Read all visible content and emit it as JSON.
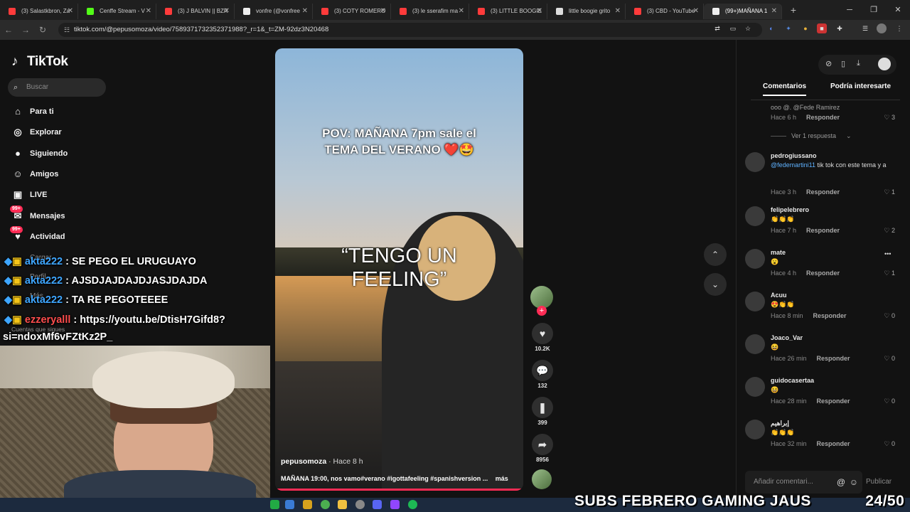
{
  "browser": {
    "tabs": [
      {
        "title": "(3) Salastkbron, Za",
        "color": "#ff3b3b"
      },
      {
        "title": "Cenffe Stream - V",
        "color": "#53fc18"
      },
      {
        "title": "(3) J BALVIN || BZR",
        "color": "#ff3b3b"
      },
      {
        "title": "vonfre (@vonfree",
        "color": "#eeeeee"
      },
      {
        "title": "(3) COTY ROMERO",
        "color": "#ff3b3b"
      },
      {
        "title": "(3) le sserafim ma",
        "color": "#ff3b3b"
      },
      {
        "title": "(3) LITTLE BOOGIE",
        "color": "#ff3b3b"
      },
      {
        "title": "little boogie grito",
        "color": "#dddddd"
      },
      {
        "title": "(3) CBD - YouTube",
        "color": "#ff3b3b"
      },
      {
        "title": "(99+)MAÑANA 1",
        "color": "#eeeeee"
      }
    ],
    "url": "tiktok.com/@pepusomoza/video/7589371732352371988?_r=1&_t=ZM-92dz3N20468"
  },
  "sidebar": {
    "logo": "TikTok",
    "search_placeholder": "Buscar",
    "items": [
      {
        "label": "Para ti",
        "icon": "home-icon",
        "glyph": "⌂"
      },
      {
        "label": "Explorar",
        "icon": "compass-icon",
        "glyph": "◎"
      },
      {
        "label": "Siguiendo",
        "icon": "following-avatar-icon",
        "glyph": "●"
      },
      {
        "label": "Amigos",
        "icon": "friends-icon",
        "glyph": "☺"
      },
      {
        "label": "LIVE",
        "icon": "live-icon",
        "glyph": "▣"
      },
      {
        "label": "Mensajes",
        "icon": "messages-icon",
        "glyph": "✉",
        "badge": "99+"
      },
      {
        "label": "Actividad",
        "icon": "activity-icon",
        "glyph": "♥",
        "badge": "99+"
      }
    ],
    "partial_items": [
      "Cargar",
      "Perfil",
      "Más"
    ],
    "following_label": "Cuentas que sigues"
  },
  "chat": [
    {
      "user": "akta222",
      "message": "SE PEGO EL URUGUAYO"
    },
    {
      "user": "akta222",
      "message": "AJSDJAJDAJDJASJDAJDA"
    },
    {
      "user": "akta222",
      "message": "TA RE PEGOTEEEE"
    },
    {
      "user": "ezzeryalll",
      "message": "https://youtu.be/DtisH7Gifd8?"
    },
    {
      "user": "",
      "message": "si=ndoxMf6vFZtKz2P_"
    }
  ],
  "video": {
    "caption_top": "POV: MAÑANA 7pm sale el TEMA DEL VERANO ❤️🤩",
    "caption_mid": "“TENGO UN FEELING”",
    "author": "pepusomoza",
    "time": "· Hace 8 h",
    "description": "MAÑANA 19:00, nos vamo#verano #igottafeeling #spanishversion ...",
    "more": "más"
  },
  "actions": {
    "likes": "10.2K",
    "comments": "132",
    "saves": "399",
    "shares": "8956"
  },
  "comments_panel": {
    "tabs": [
      "Comentarios",
      "Podría interesarte"
    ],
    "top_snippet": "ooo @. @Fede Ramirez",
    "view_replies": "Ver 1 respuesta",
    "reply_label": "Responder",
    "input_placeholder": "Añadir comentari...",
    "publish": "Publicar",
    "items": [
      {
        "user": "",
        "text": "",
        "time": "Hace 6 h",
        "likes": "3"
      },
      {
        "user": "pedrogiussano",
        "mention": "@fedemartini11",
        "text": " tik tok con este tema y a",
        "time": "Hace 3 h",
        "likes": "1"
      },
      {
        "user": "felipelebrero",
        "text": "👏👏👏",
        "time": "Hace 7 h",
        "likes": "2"
      },
      {
        "user": "mate",
        "text": "😮",
        "time": "Hace 4 h",
        "likes": "1"
      },
      {
        "user": "Acuu",
        "text": "😍👏👏",
        "time": "Hace 8 min",
        "likes": "0"
      },
      {
        "user": "Joaco_Var",
        "text": "😆",
        "time": "Hace 26 min",
        "likes": "0"
      },
      {
        "user": "guidocasertaa",
        "text": "😆",
        "time": "Hace 28 min",
        "likes": "0"
      },
      {
        "user": "إبراهيم",
        "text": "👏👏👏",
        "time": "Hace 32 min",
        "likes": "0"
      }
    ]
  },
  "overlay": {
    "subs_text": "SUBS FEBRERO GAMING JAUS",
    "subs_count": "24/50"
  },
  "colors": {
    "accent": "#fe2c55",
    "mention": "#5fb2ff",
    "chat_user": "#3ea6ff"
  }
}
